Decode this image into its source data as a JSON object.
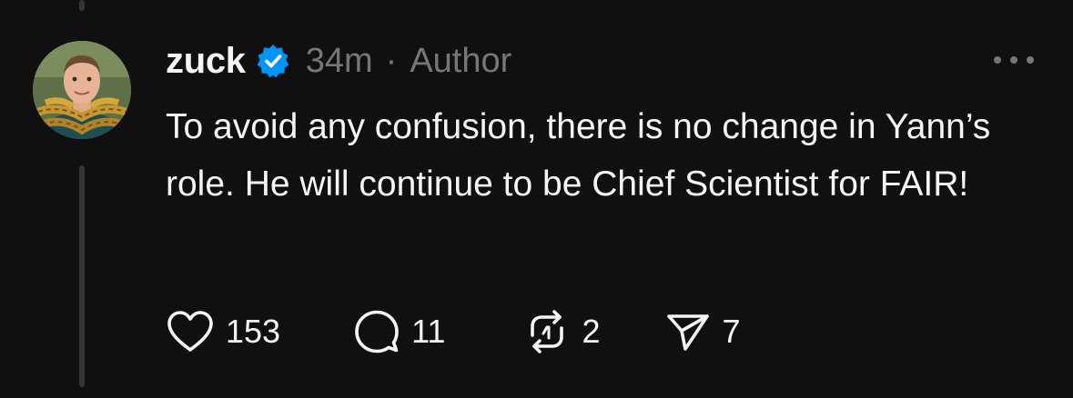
{
  "post": {
    "username": "zuck",
    "timestamp": "34m",
    "separator": "·",
    "author_tag": "Author",
    "text": "To avoid any confusion, there is no change in Yann’s role. He will continue to be Chief Scientist for FAIR!"
  },
  "actions": {
    "likes": "153",
    "replies": "11",
    "reposts": "2",
    "shares": "7"
  },
  "icons": {
    "verified": "verified-badge-icon",
    "more": "more-options-icon",
    "like": "heart-icon",
    "reply": "speech-bubble-icon",
    "repost": "repost-icon",
    "share": "send-icon"
  },
  "colors": {
    "background": "#101010",
    "text": "#f3f5f7",
    "secondary": "#777777",
    "verified": "#0095f6",
    "thread_line": "#333638"
  }
}
